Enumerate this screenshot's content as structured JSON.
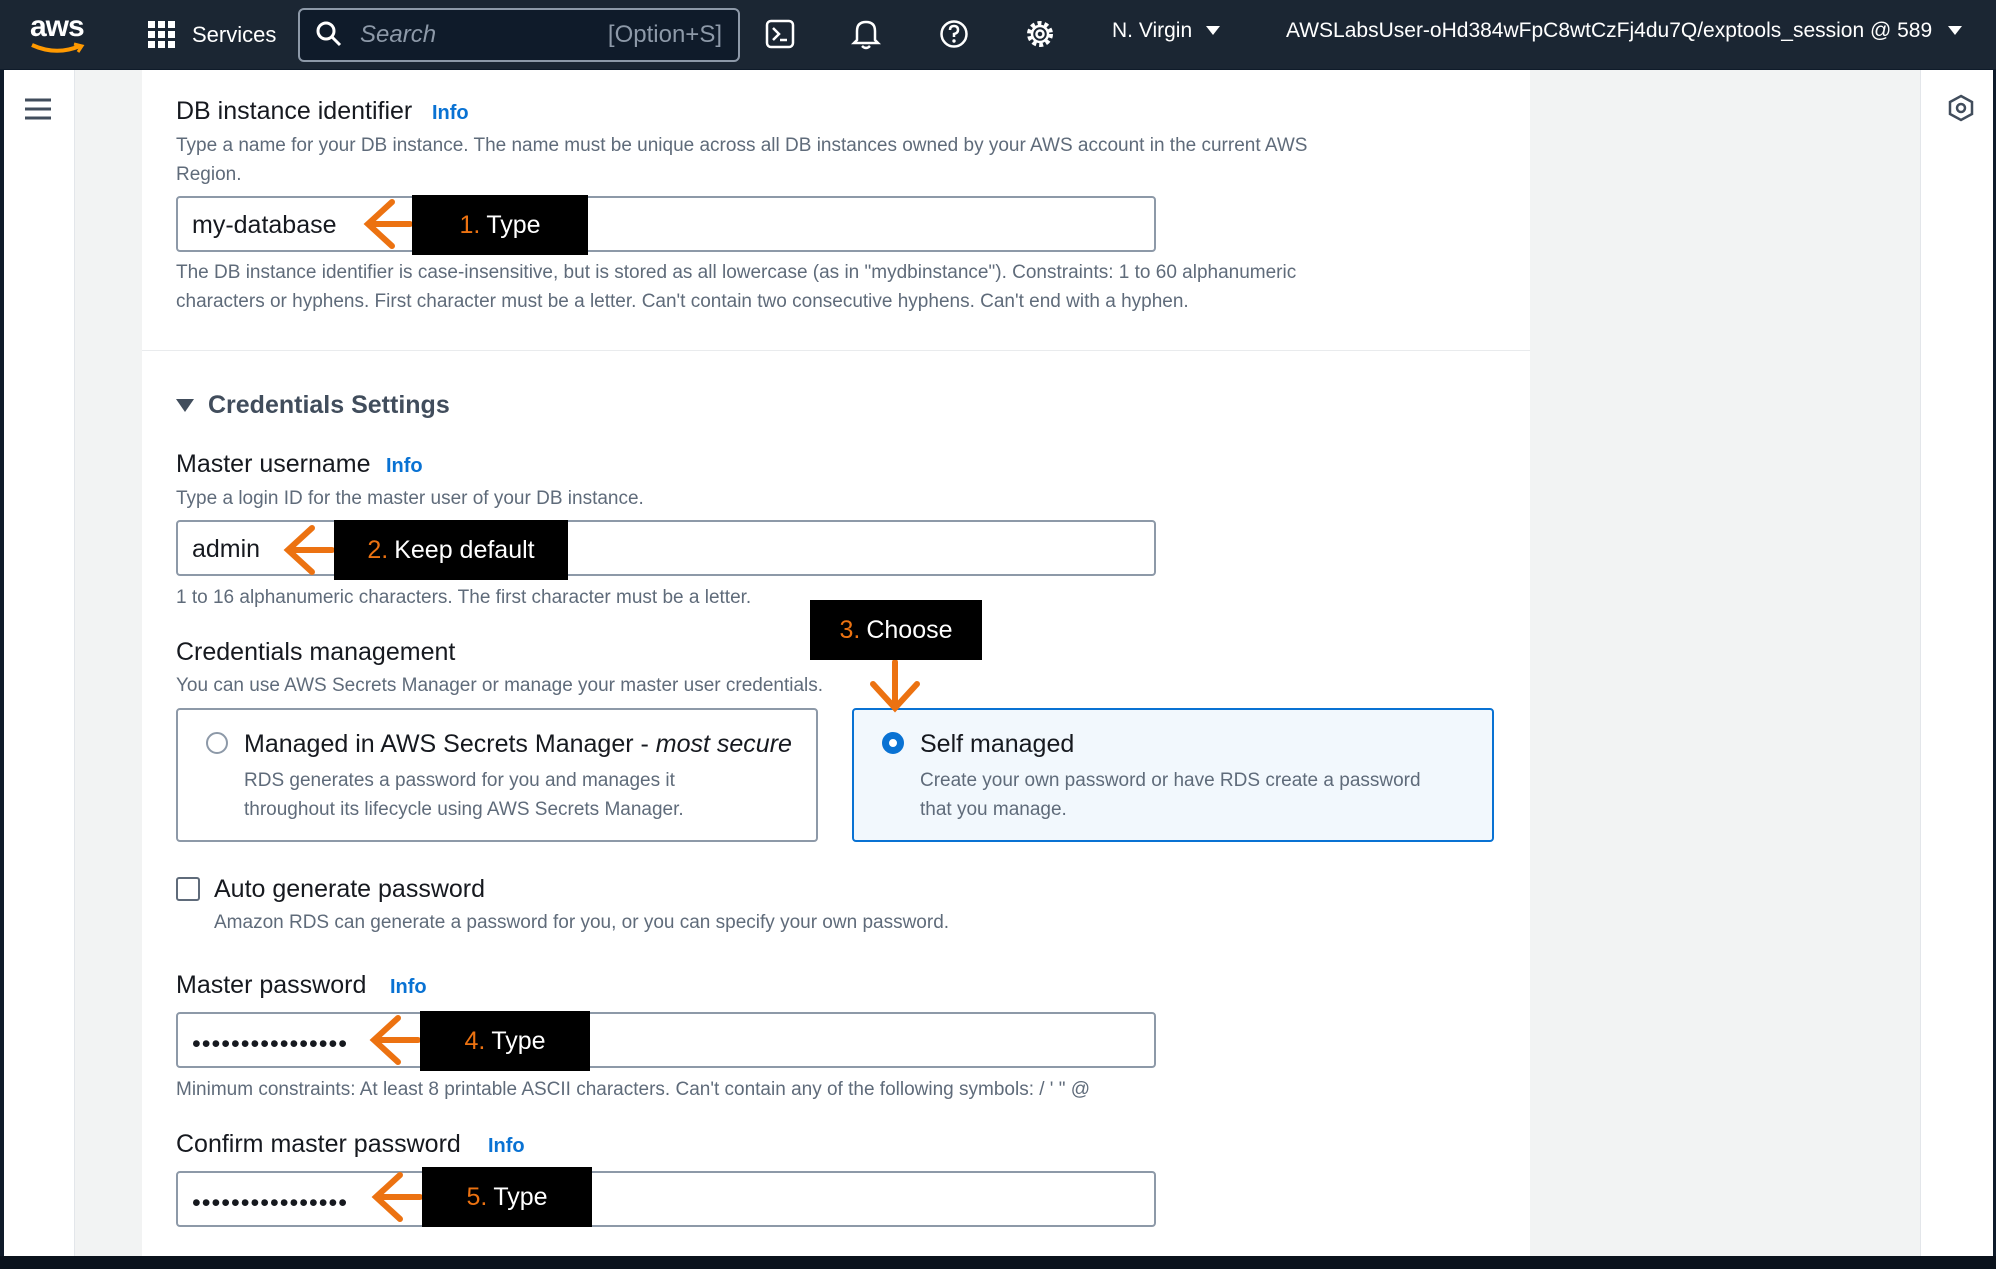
{
  "topbar": {
    "logo": "aws",
    "services": "Services",
    "search_placeholder": "Search",
    "search_hint": "[Option+S]",
    "region": "N. Virgin",
    "account": "AWSLabsUser-oHd384wFpC8wtCzFj4du7Q/exptools_session @ 589"
  },
  "db_identifier": {
    "label": "DB instance identifier",
    "info": "Info",
    "description_line1": "Type a name for your DB instance. The name must be unique across all DB instances owned by your AWS account in the current AWS",
    "description_line2": "Region.",
    "value": "my-database",
    "constraint_line1": "The DB instance identifier is case-insensitive, but is stored as all lowercase (as in \"mydbinstance\"). Constraints: 1 to 60 alphanumeric",
    "constraint_line2": "characters or hyphens. First character must be a letter. Can't contain two consecutive hyphens. Can't end with a hyphen."
  },
  "credentials_section": {
    "title": "Credentials Settings"
  },
  "master_username": {
    "label": "Master username",
    "info": "Info",
    "description": "Type a login ID for the master user of your DB instance.",
    "value": "admin",
    "constraint": "1 to 16 alphanumeric characters. The first character must be a letter."
  },
  "credentials_management": {
    "label": "Credentials management",
    "description": "You can use AWS Secrets Manager or manage your master user credentials.",
    "options": [
      {
        "title": "Managed in AWS Secrets Manager - ",
        "title_emphasis": "most secure",
        "desc_line1": "RDS generates a password for you and manages it",
        "desc_line2": "throughout its lifecycle using AWS Secrets Manager.",
        "selected": false
      },
      {
        "title": "Self managed",
        "desc_line1": "Create your own password or have RDS create a password",
        "desc_line2": "that you manage.",
        "selected": true
      }
    ]
  },
  "auto_generate": {
    "label": "Auto generate password",
    "description": "Amazon RDS can generate a password for you, or you can specify your own password.",
    "checked": false
  },
  "master_password": {
    "label": "Master password",
    "info": "Info",
    "value": "••••••••••••••••",
    "constraint": "Minimum constraints: At least 8 printable ASCII characters. Can't contain any of the following symbols: / ' \" @"
  },
  "confirm_password": {
    "label": "Confirm master password",
    "info": "Info",
    "value": "••••••••••••••••"
  },
  "callouts": [
    {
      "num": "1.",
      "text": "Type"
    },
    {
      "num": "2.",
      "text": "Keep default"
    },
    {
      "num": "3.",
      "text": "Choose"
    },
    {
      "num": "4.",
      "text": "Type"
    },
    {
      "num": "5.",
      "text": "Type"
    }
  ],
  "colors": {
    "topbar": "#1b2633",
    "link": "#0972d3",
    "callout_number": "#ec7211",
    "arrow": "#ec7211"
  }
}
